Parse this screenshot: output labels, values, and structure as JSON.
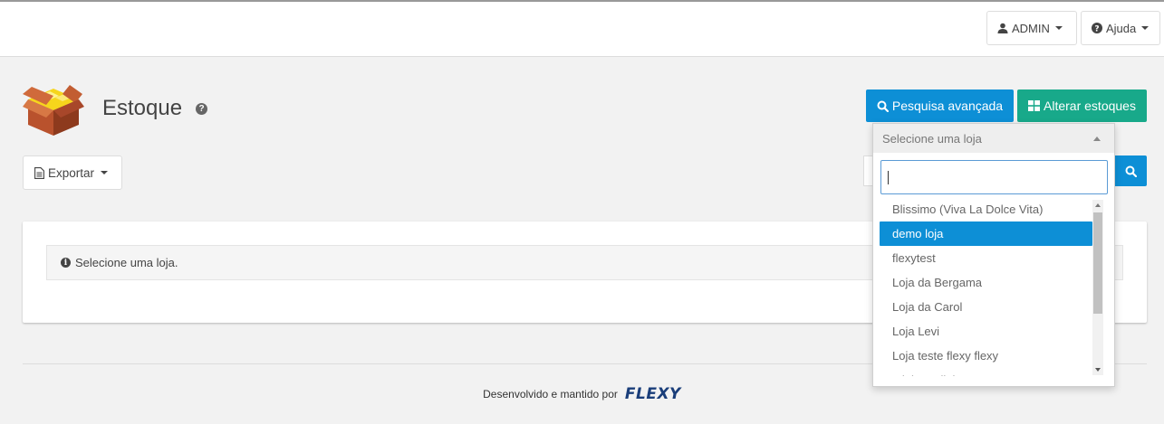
{
  "topbar": {
    "user_label": "ADMIN",
    "help_label": "Ajuda"
  },
  "page": {
    "title": "Estoque",
    "help_glyph": "?"
  },
  "actions": {
    "advanced_search_label": "Pesquisa avançada",
    "change_stock_label": "Alterar estoques",
    "export_label": "Exportar"
  },
  "panel": {
    "alert_text": "Selecione uma loja."
  },
  "store_select": {
    "placeholder": "Selecione uma loja",
    "search_value": "",
    "options": [
      "Blissimo (Viva La Dolce Vita)",
      "demo loja",
      "flexytest",
      "Loja da Bergama",
      "Loja da Carol",
      "Loja Levi",
      "Loja teste flexy flexy",
      "Minha Lojinha"
    ],
    "highlighted_index": 1
  },
  "footer": {
    "text": "Desenvolvido e mantido por",
    "brand": "FLEXY"
  },
  "colors": {
    "primary_blue": "#0d8fd6",
    "teal_green": "#18a98a",
    "brand_navy": "#1a3e7a"
  }
}
